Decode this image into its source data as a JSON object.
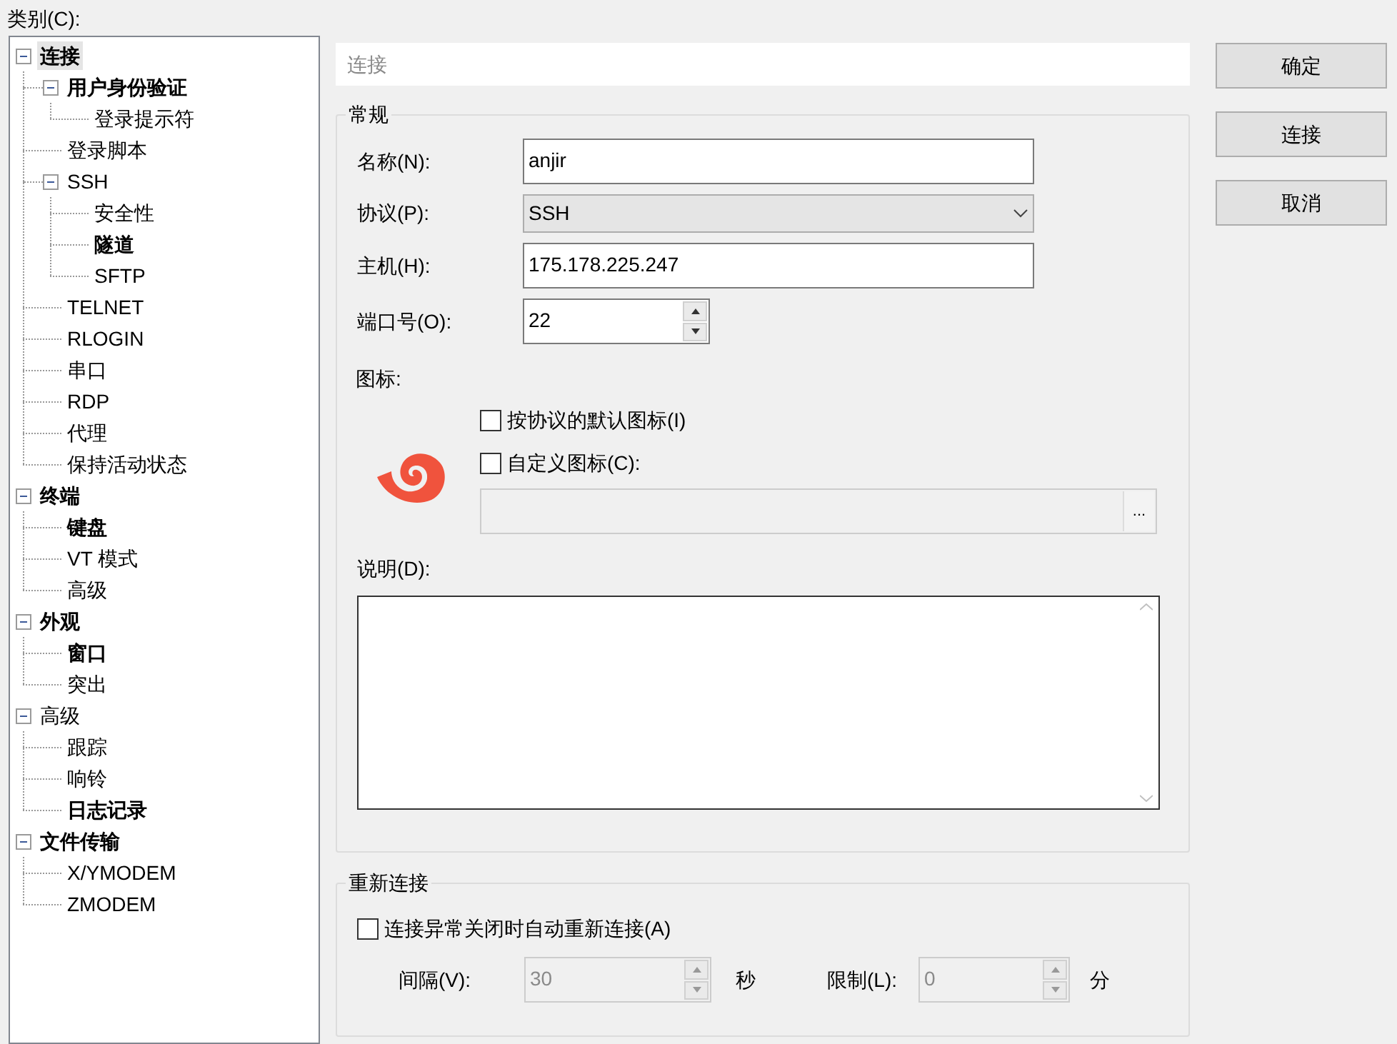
{
  "category_label": "类别(C):",
  "tree": [
    {
      "label": "连接",
      "bold": true,
      "selected": true,
      "expanded": true,
      "children": [
        {
          "label": "用户身份验证",
          "bold": true,
          "selected": false,
          "expanded": true,
          "children": [
            {
              "label": "登录提示符",
              "bold": false,
              "selected": false
            }
          ]
        },
        {
          "label": "登录脚本",
          "bold": false,
          "selected": false
        },
        {
          "label": "SSH",
          "bold": false,
          "selected": false,
          "expanded": true,
          "children": [
            {
              "label": "安全性",
              "bold": false,
              "selected": false
            },
            {
              "label": "隧道",
              "bold": true,
              "selected": false
            },
            {
              "label": "SFTP",
              "bold": false,
              "selected": false
            }
          ]
        },
        {
          "label": "TELNET",
          "bold": false,
          "selected": false
        },
        {
          "label": "RLOGIN",
          "bold": false,
          "selected": false
        },
        {
          "label": "串口",
          "bold": false,
          "selected": false
        },
        {
          "label": "RDP",
          "bold": false,
          "selected": false
        },
        {
          "label": "代理",
          "bold": false,
          "selected": false
        },
        {
          "label": "保持活动状态",
          "bold": false,
          "selected": false
        }
      ]
    },
    {
      "label": "终端",
      "bold": true,
      "selected": false,
      "expanded": true,
      "children": [
        {
          "label": "键盘",
          "bold": true,
          "selected": false
        },
        {
          "label": "VT 模式",
          "bold": false,
          "selected": false
        },
        {
          "label": "高级",
          "bold": false,
          "selected": false
        }
      ]
    },
    {
      "label": "外观",
      "bold": true,
      "selected": false,
      "expanded": true,
      "children": [
        {
          "label": "窗口",
          "bold": true,
          "selected": false
        },
        {
          "label": "突出",
          "bold": false,
          "selected": false
        }
      ]
    },
    {
      "label": "高级",
      "bold": false,
      "selected": false,
      "expanded": true,
      "children": [
        {
          "label": "跟踪",
          "bold": false,
          "selected": false
        },
        {
          "label": "响铃",
          "bold": false,
          "selected": false
        },
        {
          "label": "日志记录",
          "bold": true,
          "selected": false
        }
      ]
    },
    {
      "label": "文件传输",
      "bold": true,
      "selected": false,
      "expanded": true,
      "children": [
        {
          "label": "X/YMODEM",
          "bold": false,
          "selected": false
        },
        {
          "label": "ZMODEM",
          "bold": false,
          "selected": false
        }
      ]
    }
  ],
  "panel_title": "连接",
  "general": {
    "title": "常规",
    "fields": [
      {
        "kind": "text",
        "label": "名称(N):",
        "value": "anjir"
      },
      {
        "kind": "select",
        "label": "协议(P):",
        "value": "SSH"
      },
      {
        "kind": "text",
        "label": "主机(H):",
        "value": "175.178.225.247"
      },
      {
        "kind": "spin",
        "label": "端口号(O):",
        "value": "22"
      }
    ],
    "icon_label": "图标:",
    "default_icon": {
      "label": "按协议的默认图标(I)",
      "checked": false
    },
    "custom_icon": {
      "label": "自定义图标(C):",
      "checked": false
    },
    "browse_button": "...",
    "description_label": "说明(D):"
  },
  "reconnect": {
    "title": "重新连接",
    "auto": {
      "label": "连接异常关闭时自动重新连接(A)",
      "checked": false
    },
    "interval": {
      "label": "间隔(V):",
      "value": "30",
      "unit": "秒"
    },
    "limit": {
      "label": "限制(L):",
      "value": "0",
      "unit": "分"
    }
  },
  "buttons": [
    "确定",
    "连接",
    "取消"
  ]
}
